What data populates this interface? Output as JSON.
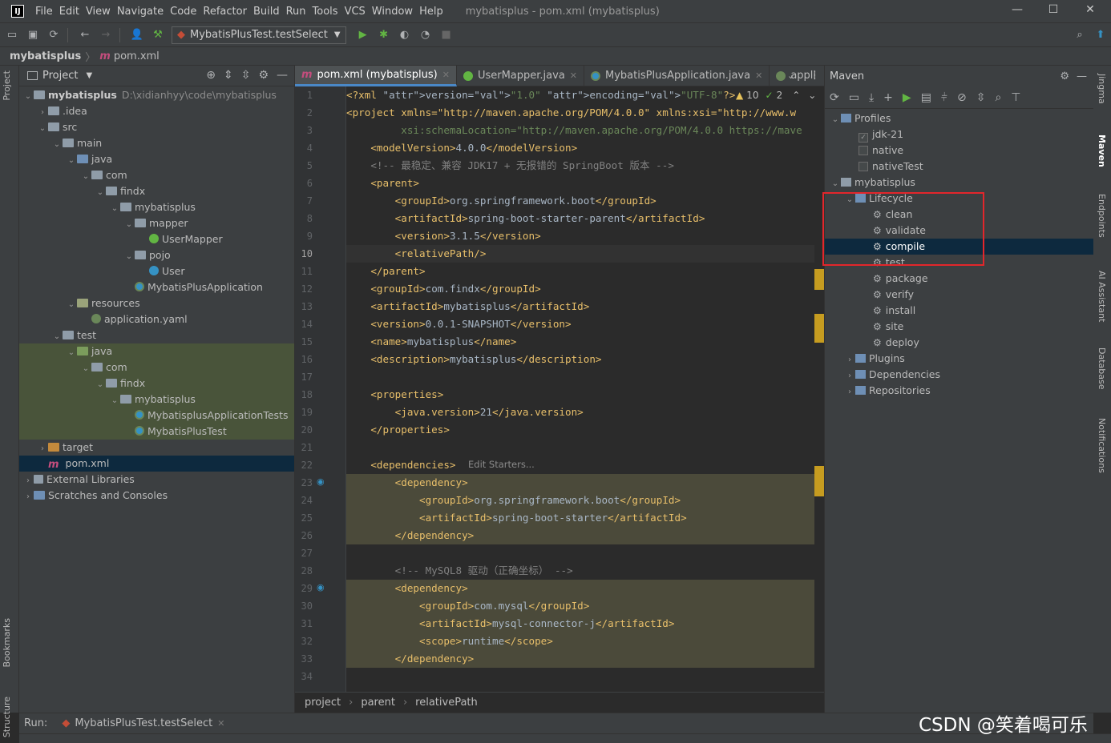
{
  "menubar": {
    "logo": "IJ",
    "items": [
      "File",
      "Edit",
      "View",
      "Navigate",
      "Code",
      "Refactor",
      "Build",
      "Run",
      "Tools",
      "VCS",
      "Window",
      "Help"
    ],
    "title": "mybatisplus - pom.xml (mybatisplus)"
  },
  "toolbar": {
    "run_config": "MybatisPlusTest.testSelect"
  },
  "breadcrumb": {
    "root": "mybatisplus",
    "file": "pom.xml"
  },
  "left_strip": {
    "top": "Project",
    "bookmarks": "Bookmarks",
    "structure": "Structure"
  },
  "project": {
    "header": "Project",
    "tree": [
      {
        "label": "mybatisplus",
        "hint": "D:\\xidianhyy\\code\\mybatisplus"
      },
      {
        "label": ".idea"
      },
      {
        "label": "src"
      },
      {
        "label": "main"
      },
      {
        "label": "java"
      },
      {
        "label": "com"
      },
      {
        "label": "findx"
      },
      {
        "label": "mybatisplus"
      },
      {
        "label": "mapper"
      },
      {
        "label": "UserMapper"
      },
      {
        "label": "pojo"
      },
      {
        "label": "User"
      },
      {
        "label": "MybatisPlusApplication"
      },
      {
        "label": "resources"
      },
      {
        "label": "application.yaml"
      },
      {
        "label": "test"
      },
      {
        "label": "java"
      },
      {
        "label": "com"
      },
      {
        "label": "findx"
      },
      {
        "label": "mybatisplus"
      },
      {
        "label": "MybatisplusApplicationTests"
      },
      {
        "label": "MybatisPlusTest"
      },
      {
        "label": "target"
      },
      {
        "label": "pom.xml"
      },
      {
        "label": "External Libraries"
      },
      {
        "label": "Scratches and Consoles"
      }
    ]
  },
  "editor": {
    "tabs": [
      {
        "label": "pom.xml (mybatisplus)"
      },
      {
        "label": "UserMapper.java"
      },
      {
        "label": "MybatisPlusApplication.java"
      },
      {
        "label": "appli"
      }
    ],
    "inspections": {
      "warnings": "10",
      "ok": "2"
    },
    "line_numbers": [
      "1",
      "2",
      "3",
      "4",
      "5",
      "6",
      "7",
      "8",
      "9",
      "10",
      "11",
      "12",
      "13",
      "14",
      "15",
      "16",
      "17",
      "18",
      "19",
      "20",
      "21",
      "22",
      "23",
      "24",
      "25",
      "26",
      "27",
      "28",
      "29",
      "30",
      "31",
      "32",
      "33",
      "34"
    ],
    "lines": [
      "<?xml version=\"1.0\" encoding=\"UTF-8\"?>",
      "<project xmlns=\"http://maven.apache.org/POM/4.0.0\" xmlns:xsi=\"http://www.w",
      "         xsi:schemaLocation=\"http://maven.apache.org/POM/4.0.0 https://mave",
      "    <modelVersion>4.0.0</modelVersion>",
      "    <!-- 最稳定、兼容 JDK17 + 无报错的 SpringBoot 版本 -->",
      "    <parent>",
      "        <groupId>org.springframework.boot</groupId>",
      "        <artifactId>spring-boot-starter-parent</artifactId>",
      "        <version>3.1.5</version>",
      "        <relativePath/>",
      "    </parent>",
      "    <groupId>com.findx</groupId>",
      "    <artifactId>mybatisplus</artifactId>",
      "    <version>0.0.1-SNAPSHOT</version>",
      "    <name>mybatisplus</name>",
      "    <description>mybatisplus</description>",
      "",
      "    <properties>",
      "        <java.version>21</java.version>",
      "    </properties>",
      "",
      "    <dependencies>",
      "        <dependency>",
      "            <groupId>org.springframework.boot</groupId>",
      "            <artifactId>spring-boot-starter</artifactId>",
      "        </dependency>",
      "",
      "        <!-- MySQL8 驱动（正确坐标） -->",
      "        <dependency>",
      "            <groupId>com.mysql</groupId>",
      "            <artifactId>mysql-connector-j</artifactId>",
      "            <scope>runtime</scope>",
      "        </dependency>",
      ""
    ],
    "edit_starters": "Edit Starters...",
    "crumbs": [
      "project",
      "parent",
      "relativePath"
    ]
  },
  "maven": {
    "header": "Maven",
    "rows": [
      {
        "label": "Profiles"
      },
      {
        "label": "jdk-21"
      },
      {
        "label": "native"
      },
      {
        "label": "nativeTest"
      },
      {
        "label": "mybatisplus"
      },
      {
        "label": "Lifecycle"
      },
      {
        "label": "clean"
      },
      {
        "label": "validate"
      },
      {
        "label": "compile"
      },
      {
        "label": "test"
      },
      {
        "label": "package"
      },
      {
        "label": "verify"
      },
      {
        "label": "install"
      },
      {
        "label": "site"
      },
      {
        "label": "deploy"
      },
      {
        "label": "Plugins"
      },
      {
        "label": "Dependencies"
      },
      {
        "label": "Repositories"
      }
    ]
  },
  "right_strip": [
    "Jingma",
    "Maven",
    "Endpoints",
    "AI Assistant",
    "Database",
    "Notifications"
  ],
  "run": {
    "label": "Run:",
    "config": "MybatisPlusTest.testSelect"
  },
  "watermark": "CSDN @笑着喝可乐",
  "colors": {
    "accent": "#4a88c7",
    "highlight_box": "#e3262b",
    "selection": "#0d293e"
  }
}
